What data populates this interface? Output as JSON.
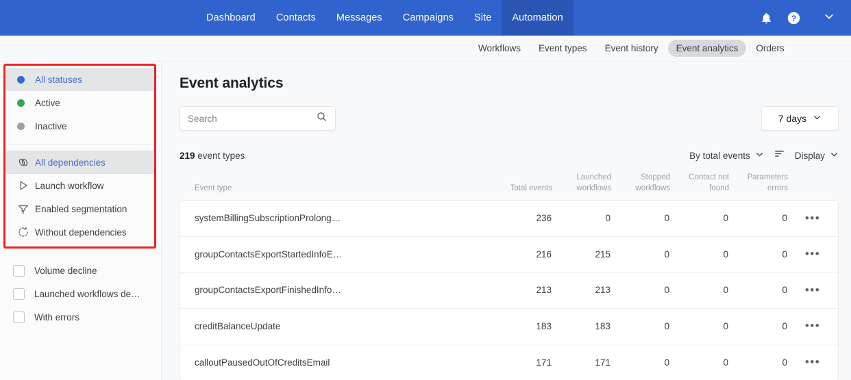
{
  "topnav": {
    "items": [
      {
        "label": "Dashboard",
        "active": false
      },
      {
        "label": "Contacts",
        "active": false
      },
      {
        "label": "Messages",
        "active": false
      },
      {
        "label": "Campaigns",
        "active": false
      },
      {
        "label": "Site",
        "active": false
      },
      {
        "label": "Automation",
        "active": true
      }
    ],
    "icons": {
      "bell": "bell-icon",
      "help": "help-icon",
      "chevron": "chevron-down-icon"
    }
  },
  "subnav": {
    "items": [
      {
        "label": "Workflows",
        "active": false
      },
      {
        "label": "Event types",
        "active": false
      },
      {
        "label": "Event history",
        "active": false
      },
      {
        "label": "Event analytics",
        "active": true
      },
      {
        "label": "Orders",
        "active": false
      }
    ]
  },
  "sidebar": {
    "statuses": [
      {
        "label": "All statuses",
        "dot": "#2f6bd6",
        "selected": true
      },
      {
        "label": "Active",
        "dot": "#34a853",
        "selected": false
      },
      {
        "label": "Inactive",
        "dot": "#9aa0a6",
        "selected": false
      }
    ],
    "dependencies": [
      {
        "label": "All dependencies",
        "icon": "link-chain-icon",
        "selected": true
      },
      {
        "label": "Launch workflow",
        "icon": "play-triangle-icon",
        "selected": false
      },
      {
        "label": "Enabled segmentation",
        "icon": "funnel-filter-icon",
        "selected": false
      },
      {
        "label": "Without dependencies",
        "icon": "dashed-refresh-icon",
        "selected": false
      }
    ],
    "checkboxes": [
      {
        "label": "Volume decline",
        "checked": false
      },
      {
        "label": "Launched workflows de…",
        "checked": false
      },
      {
        "label": "With errors",
        "checked": false
      }
    ]
  },
  "main": {
    "title": "Event analytics",
    "search": {
      "value": "",
      "placeholder": "Search"
    },
    "range_button": {
      "label": "7 days"
    },
    "count": {
      "number": "219",
      "unit": "event types"
    },
    "sort_control": {
      "label": "By total events"
    },
    "display_control": {
      "label": "Display"
    },
    "table": {
      "columns": [
        "Event type",
        "Total events",
        "Launched workflows",
        "Stopped workflows",
        "Contact not found",
        "Parameters errors"
      ],
      "rows": [
        {
          "event_type": "systemBillingSubscriptionProlong…",
          "total": "236",
          "launched": "0",
          "stopped": "0",
          "not_found": "0",
          "param_errors": "0",
          "actions": "•••"
        },
        {
          "event_type": "groupContactsExportStartedInfoE…",
          "total": "216",
          "launched": "215",
          "stopped": "0",
          "not_found": "0",
          "param_errors": "0",
          "actions": "•••"
        },
        {
          "event_type": "groupContactsExportFinishedInfo…",
          "total": "213",
          "launched": "213",
          "stopped": "0",
          "not_found": "0",
          "param_errors": "0",
          "actions": "•••"
        },
        {
          "event_type": "creditBalanceUpdate",
          "total": "183",
          "launched": "183",
          "stopped": "0",
          "not_found": "0",
          "param_errors": "0",
          "actions": "•••"
        },
        {
          "event_type": "calloutPausedOutOfCreditsEmail",
          "total": "171",
          "launched": "171",
          "stopped": "0",
          "not_found": "0",
          "param_errors": "0",
          "actions": "•••"
        }
      ]
    }
  },
  "annotation": {
    "highlight_color": "#ee2222"
  }
}
